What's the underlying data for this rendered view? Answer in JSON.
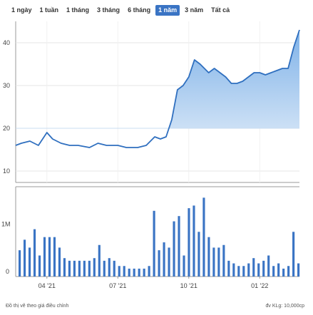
{
  "range_tabs": [
    {
      "label": "1 ngày",
      "active": false
    },
    {
      "label": "1 tuần",
      "active": false
    },
    {
      "label": "1 tháng",
      "active": false
    },
    {
      "label": "3 tháng",
      "active": false
    },
    {
      "label": "6 tháng",
      "active": false
    },
    {
      "label": "1 năm",
      "active": true
    },
    {
      "label": "3 năm",
      "active": false
    },
    {
      "label": "Tất cả",
      "active": false
    }
  ],
  "footer": {
    "note": "Đồ thị vẽ theo giá điều chỉnh",
    "volume_unit": "đv KLg: 10,000cp"
  },
  "colors": {
    "line": "#2f6fbf",
    "area_top": "#7fb2e8",
    "area_bottom": "#dbe9f8",
    "bars": "#3a74c4",
    "active_tab": "#3a74c4"
  },
  "chart_data": [
    {
      "type": "area",
      "ylim": [
        10,
        43
      ],
      "yticks": [
        10,
        20,
        30,
        40
      ],
      "y_tick_labels": [
        "10",
        "20",
        "30",
        "40"
      ],
      "grid": true,
      "x": [
        0,
        0.02,
        0.05,
        0.08,
        0.11,
        0.13,
        0.16,
        0.19,
        0.22,
        0.26,
        0.29,
        0.32,
        0.36,
        0.39,
        0.43,
        0.46,
        0.49,
        0.51,
        0.53,
        0.55,
        0.57,
        0.59,
        0.61,
        0.63,
        0.65,
        0.68,
        0.7,
        0.72,
        0.74,
        0.76,
        0.78,
        0.8,
        0.82,
        0.84,
        0.86,
        0.88,
        0.9,
        0.92,
        0.94,
        0.96,
        0.98,
        1.0
      ],
      "values": [
        16,
        16.5,
        17,
        16,
        19,
        17.5,
        16.5,
        16,
        16,
        15.5,
        16.5,
        16,
        16,
        15.5,
        15.5,
        16,
        18,
        17.5,
        18,
        22,
        29,
        30,
        32,
        36,
        35,
        33,
        34,
        33,
        32,
        30.5,
        30.5,
        31,
        32,
        33,
        33,
        32.5,
        33,
        33.5,
        34,
        34,
        39,
        43
      ]
    },
    {
      "type": "bar",
      "series_label": "Volume",
      "y_tick_labels": [
        "0",
        "1M"
      ],
      "ylim": [
        0,
        1.6
      ],
      "values": [
        0.5,
        0.7,
        0.55,
        0.9,
        0.4,
        0.75,
        0.75,
        0.75,
        0.55,
        0.35,
        0.3,
        0.3,
        0.3,
        0.3,
        0.3,
        0.35,
        0.6,
        0.3,
        0.35,
        0.3,
        0.2,
        0.2,
        0.15,
        0.15,
        0.15,
        0.15,
        0.2,
        1.25,
        0.5,
        0.65,
        0.55,
        1.05,
        1.15,
        0.4,
        1.3,
        1.35,
        0.85,
        1.5,
        0.75,
        0.55,
        0.55,
        0.6,
        0.3,
        0.25,
        0.2,
        0.2,
        0.25,
        0.35,
        0.25,
        0.3,
        0.4,
        0.2,
        0.25,
        0.15,
        0.2,
        0.85,
        0.25
      ]
    }
  ],
  "x_axis": {
    "tick_labels": [
      "04 '21",
      "07 '21",
      "10 '21",
      "01 '22"
    ],
    "tick_positions": [
      0.11,
      0.36,
      0.61,
      0.86
    ]
  }
}
